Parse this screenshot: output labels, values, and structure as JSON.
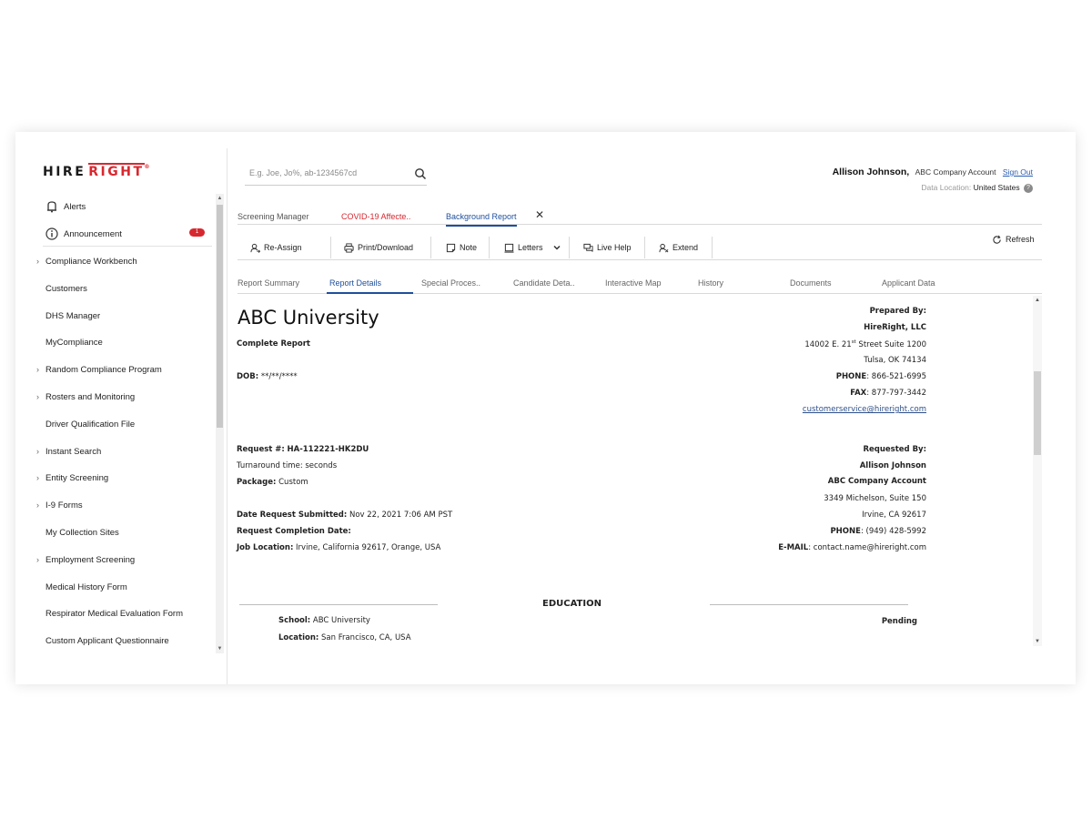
{
  "brand": {
    "logo_left": "HIRE",
    "logo_right": "RIGHT",
    "logo_tm": "®"
  },
  "sidebar": {
    "alerts": "Alerts",
    "announcement": "Announcement",
    "announcement_badge": "1",
    "items": [
      {
        "label": "Compliance Workbench",
        "expandable": true
      },
      {
        "label": "Customers",
        "expandable": false
      },
      {
        "label": "DHS Manager",
        "expandable": false
      },
      {
        "label": "MyCompliance",
        "expandable": false
      },
      {
        "label": "Random Compliance Program",
        "expandable": true
      },
      {
        "label": "Rosters and Monitoring",
        "expandable": true
      },
      {
        "label": "Driver Qualification File",
        "expandable": false
      },
      {
        "label": "Instant Search",
        "expandable": true
      },
      {
        "label": "Entity Screening",
        "expandable": true
      },
      {
        "label": "I-9 Forms",
        "expandable": true
      },
      {
        "label": "My Collection Sites",
        "expandable": false
      },
      {
        "label": "Employment Screening",
        "expandable": true
      },
      {
        "label": "Medical History Form",
        "expandable": false
      },
      {
        "label": "Respirator Medical Evaluation Form",
        "expandable": false
      },
      {
        "label": "Custom Applicant Questionnaire",
        "expandable": false
      }
    ]
  },
  "search": {
    "placeholder": "E.g. Joe, Jo%, ab-1234567cd"
  },
  "user": {
    "name": "Allison Johnson,",
    "account": "ABC Company Account",
    "signout": "Sign Out",
    "location_label": "Data Location:",
    "location_value": "United States"
  },
  "tabs": [
    {
      "label": "Screening Manager",
      "color": "#555555"
    },
    {
      "label": "COVID-19 Affecte..",
      "color": "#d7282f"
    },
    {
      "label": "Background Report",
      "color": "#1e4f9c",
      "active": true
    }
  ],
  "toolbar": {
    "reassign": "Re-Assign",
    "print": "Print/Download",
    "note": "Note",
    "letters": "Letters",
    "livehelp": "Live Help",
    "extend": "Extend",
    "refresh": "Refresh"
  },
  "subtabs": [
    "Report Summary",
    "Report Details",
    "Special Proces..",
    "Candidate Deta..",
    "Interactive Map",
    "History",
    "Documents",
    "Applicant Data"
  ],
  "subtab_active": "Report Details",
  "report": {
    "org": "ABC University",
    "report_type": "Complete Report",
    "dob_label": "DOB:",
    "dob_value": "**/**/****",
    "prepared_by_label": "Prepared By:",
    "prepared_by_org": "HireRight, LLC",
    "prep_addr_pre": "14002 E. 21",
    "prep_addr_sup": "st",
    "prep_addr_post": " Street Suite 1200",
    "prep_city": "Tulsa, OK 74134",
    "prep_phone_label": "PHONE",
    "prep_phone": ": 866-521-6995",
    "prep_fax_label": "FAX",
    "prep_fax": ": 877-797-3442",
    "prep_email": "customerservice@hireright.com",
    "request_label": "Request #:",
    "request_value": "HA-112221-HK2DU",
    "turnaround": "Turnaround time: seconds",
    "package_label": "Package:",
    "package_value": "Custom",
    "date_submitted_label": "Date Request Submitted:",
    "date_submitted_value": "Nov 22, 2021 7:06 AM PST",
    "completion_label": "Request Completion Date:",
    "job_location_label": "Job Location:",
    "job_location_value": "Irvine, California 92617, Orange, USA",
    "requested_by_label": "Requested By:",
    "requested_by_name": "Allison Johnson",
    "requested_by_account": "ABC Company Account",
    "req_addr": "3349 Michelson, Suite 150",
    "req_city": "Irvine, CA 92617",
    "req_phone_label": "PHONE",
    "req_phone": ": (949) 428-5992",
    "req_email_label": "E-MAIL",
    "req_email": ": contact.name@hireright.com",
    "education_heading": "EDUCATION",
    "school_label": "School:",
    "school_value": "ABC University",
    "location_label": "Location:",
    "location_value": "San Francisco, CA, USA",
    "status": "Pending"
  }
}
